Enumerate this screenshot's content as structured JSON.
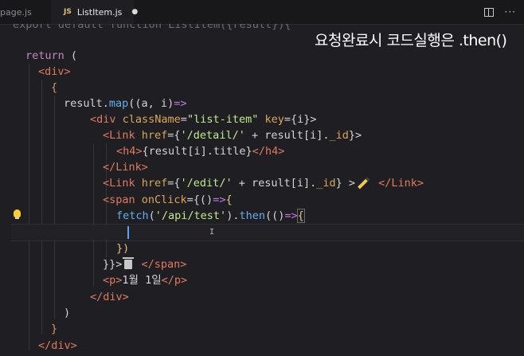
{
  "tabs": [
    {
      "label": "page.js",
      "active": false
    },
    {
      "label": "ListItem.js",
      "active": true,
      "badge": "JS",
      "modified": true
    }
  ],
  "caption": "요청완료시 코드실행은 .then()",
  "code": {
    "l0": "export default function ListItem({result}){",
    "l1_kw": "return",
    "l1_rest": " (",
    "l2": "<div>",
    "l3": "{",
    "l4_a": "result.",
    "l4_b": "map",
    "l4_c": "((a, i)",
    "l4_d": "=>",
    "l5_a": "<div",
    "l5_b": " className",
    "l5_c": "=",
    "l5_d": "\"list-item\"",
    "l5_e": " key",
    "l5_f": "={i}>",
    "l6_a": "<Link",
    "l6_b": " href",
    "l6_c": "={",
    "l6_d": "'/detail/'",
    "l6_e": " + result[i].",
    "l6_f": "_id",
    "l6_g": "}>",
    "l7_a": "<h4>",
    "l7_b": "{result[i].title}",
    "l7_c": "</h4>",
    "l8": "</Link>",
    "l9_a": "<Link",
    "l9_b": " href",
    "l9_c": "={",
    "l9_d": "'/edit/'",
    "l9_e": " + result[i].",
    "l9_f": "_id",
    "l9_g": "} >",
    "l9_h": " </Link>",
    "l10_a": "<span",
    "l10_b": " onClick",
    "l10_c": "={()",
    "l10_d": "=>",
    "l10_e": "{",
    "l11_a": "fetch",
    "l11_b": "(",
    "l11_c": "'/api/test'",
    "l11_d": ").",
    "l11_e": "then",
    "l11_f": "(()",
    "l11_g": "=>",
    "l11_h": "{",
    "l13": "})",
    "l14_a": "}}>",
    "l14_b": " </span>",
    "l15_a": "<p>",
    "l15_b": "1월 1일",
    "l15_c": "</p>",
    "l16": "</div>",
    "l17": ")",
    "l18": "}",
    "l19": "</div>"
  },
  "icons": [
    "js-file-icon",
    "split-editor-icon",
    "more-actions-icon",
    "lightbulb-icon",
    "pencil-emoji-icon",
    "trash-emoji-icon"
  ],
  "colors": {
    "background": "#1f1f23",
    "keyword": "#c586c0",
    "string": "#c3e88d",
    "function": "#61afef",
    "tag": "#e07a5f",
    "cursor": "#5ea0ff"
  }
}
